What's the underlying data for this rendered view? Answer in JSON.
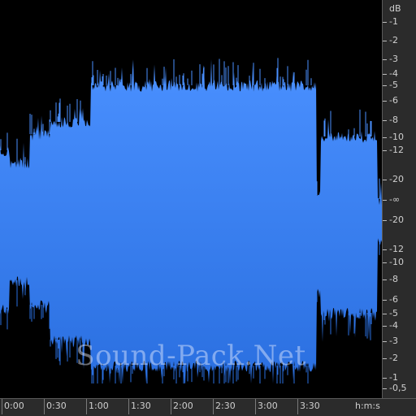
{
  "watermark": "Sound-Pack.Net",
  "db_scale": {
    "unit_label": "dB",
    "labels": [
      "-1",
      "-2",
      "-3",
      "-4",
      "-5",
      "-6",
      "-8",
      "-10",
      "-12",
      "-20",
      "-∞",
      "-20",
      "-12",
      "-10",
      "-8",
      "-6",
      "-5",
      "-4",
      "-3",
      "-2",
      "-1",
      "-0,5"
    ]
  },
  "time_ruler": {
    "labels": [
      "0:00",
      "0:30",
      "1:00",
      "1:30",
      "2:00",
      "2:30",
      "3:00",
      "3:30"
    ],
    "unit_label": "h:m:s"
  },
  "colors": {
    "background": "#000000",
    "wave_top": "#4a90ff",
    "wave_bottom": "#2a6fe0",
    "ruler_bg": "#2b2b2b",
    "ruler_text": "#cfcfcf"
  }
}
